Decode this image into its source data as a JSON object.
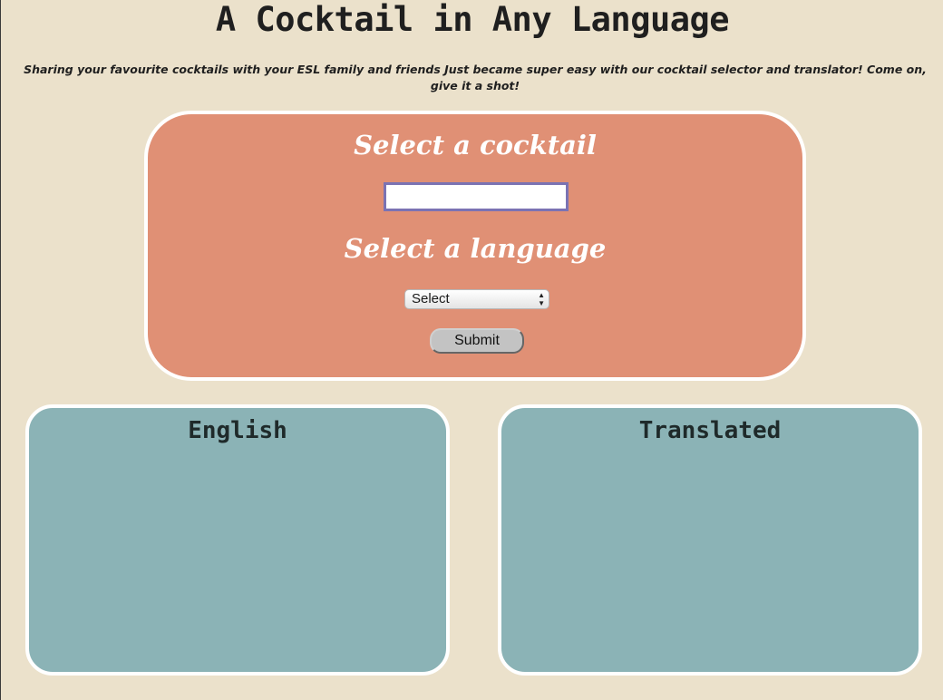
{
  "header": {
    "title": "A Cocktail in Any Language",
    "tagline": "Sharing your favourite cocktails with your ESL family and friends Just became super easy with our cocktail selector and translator! Come on, give it a shot!"
  },
  "form": {
    "cocktail_heading": "Select a cocktail",
    "cocktail_input_value": "",
    "language_heading": "Select a language",
    "language_select_value": "Select",
    "submit_label": "Submit"
  },
  "results": {
    "english_heading": "English",
    "translated_heading": "Translated"
  },
  "colors": {
    "background": "#ebe1cb",
    "form_card": "#e09075",
    "result_card": "#8bb3b6",
    "input_border": "#7b73b3"
  },
  "icons": {
    "select_arrows": "updown-chevron-icon"
  }
}
